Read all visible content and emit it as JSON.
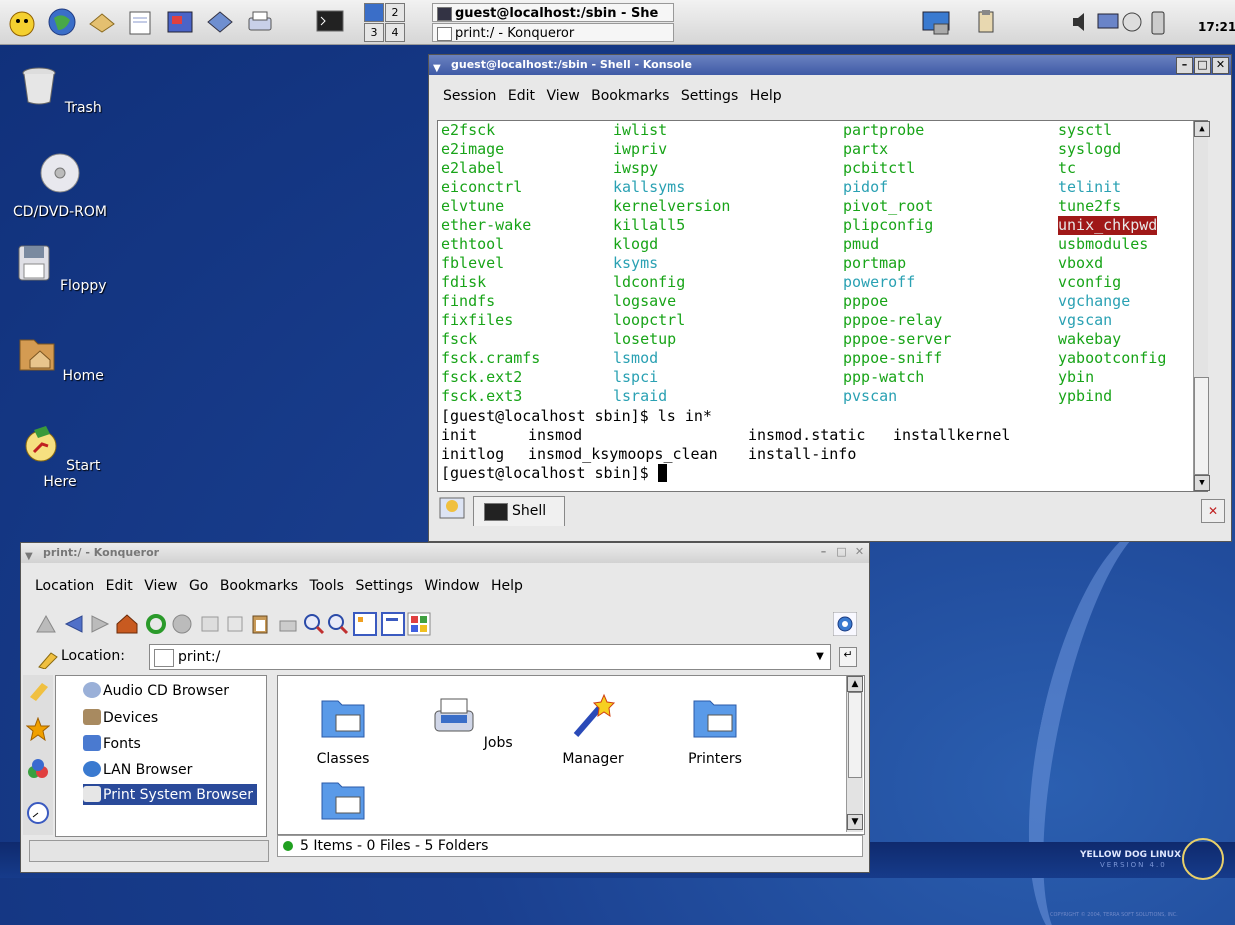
{
  "panel": {
    "pager": [
      "2",
      "3",
      "4"
    ],
    "tasks": [
      "guest@localhost:/sbin - She",
      "print:/ - Konqueror"
    ],
    "clock": "17:21"
  },
  "desktop": {
    "icons": [
      "Trash",
      "CD/DVD-ROM",
      "Floppy",
      "Home",
      "Start Here"
    ],
    "brand": "YELLOW DOG LINUX",
    "brand_sub": "VERSION 4.0",
    "copyright": "COPYRIGHT © 2004, TERRA SOFT SOLUTIONS, INC."
  },
  "konsole": {
    "title": "guest@localhost:/sbin - Shell - Konsole",
    "menu": [
      "Session",
      "Edit",
      "View",
      "Bookmarks",
      "Settings",
      "Help"
    ],
    "columns": [
      [
        "e2fsck",
        "e2image",
        "e2label",
        "eiconctrl",
        "elvtune",
        "ether-wake",
        "ethtool",
        "fblevel",
        "fdisk",
        "findfs",
        "fixfiles",
        "fsck",
        "fsck.cramfs",
        "fsck.ext2",
        "fsck.ext3"
      ],
      [
        "iwlist",
        "iwpriv",
        "iwspy",
        "kallsyms",
        "kernelversion",
        "killall5",
        "klogd",
        "ksyms",
        "ldconfig",
        "logsave",
        "loopctrl",
        "losetup",
        "lsmod",
        "lspci",
        "lsraid"
      ],
      [
        "partprobe",
        "partx",
        "pcbitctl",
        "pidof",
        "pivot_root",
        "plipconfig",
        "pmud",
        "portmap",
        "poweroff",
        "pppoe",
        "pppoe-relay",
        "pppoe-server",
        "pppoe-sniff",
        "ppp-watch",
        "pvscan"
      ],
      [
        "sysctl",
        "syslogd",
        "tc",
        "telinit",
        "tune2fs",
        "unix_chkpwd",
        "usbmodules",
        "vboxd",
        "vconfig",
        "vgchange",
        "vgscan",
        "wakebay",
        "yabootconfig",
        "ybin",
        "ypbind"
      ]
    ],
    "cmd_line": "[guest@localhost sbin]$ ls in*",
    "out1": [
      "init",
      "insmod",
      "insmod.static",
      "installkernel"
    ],
    "out2": [
      "initlog",
      "insmod_ksymoops_clean",
      "install-info"
    ],
    "prompt": "[guest@localhost sbin]$ ",
    "tab": "Shell"
  },
  "konqueror": {
    "title": "print:/ - Konqueror",
    "menu": [
      "Location",
      "Edit",
      "View",
      "Go",
      "Bookmarks",
      "Tools",
      "Settings",
      "Window",
      "Help"
    ],
    "location_label": "Location:",
    "location_value": "print:/",
    "tree": [
      "Audio CD Browser",
      "Devices",
      "Fonts",
      "LAN Browser",
      "Print System Browser"
    ],
    "files": [
      "Classes",
      "Jobs",
      "Manager",
      "Printers"
    ],
    "status": "5 Items - 0 Files - 5 Folders"
  }
}
